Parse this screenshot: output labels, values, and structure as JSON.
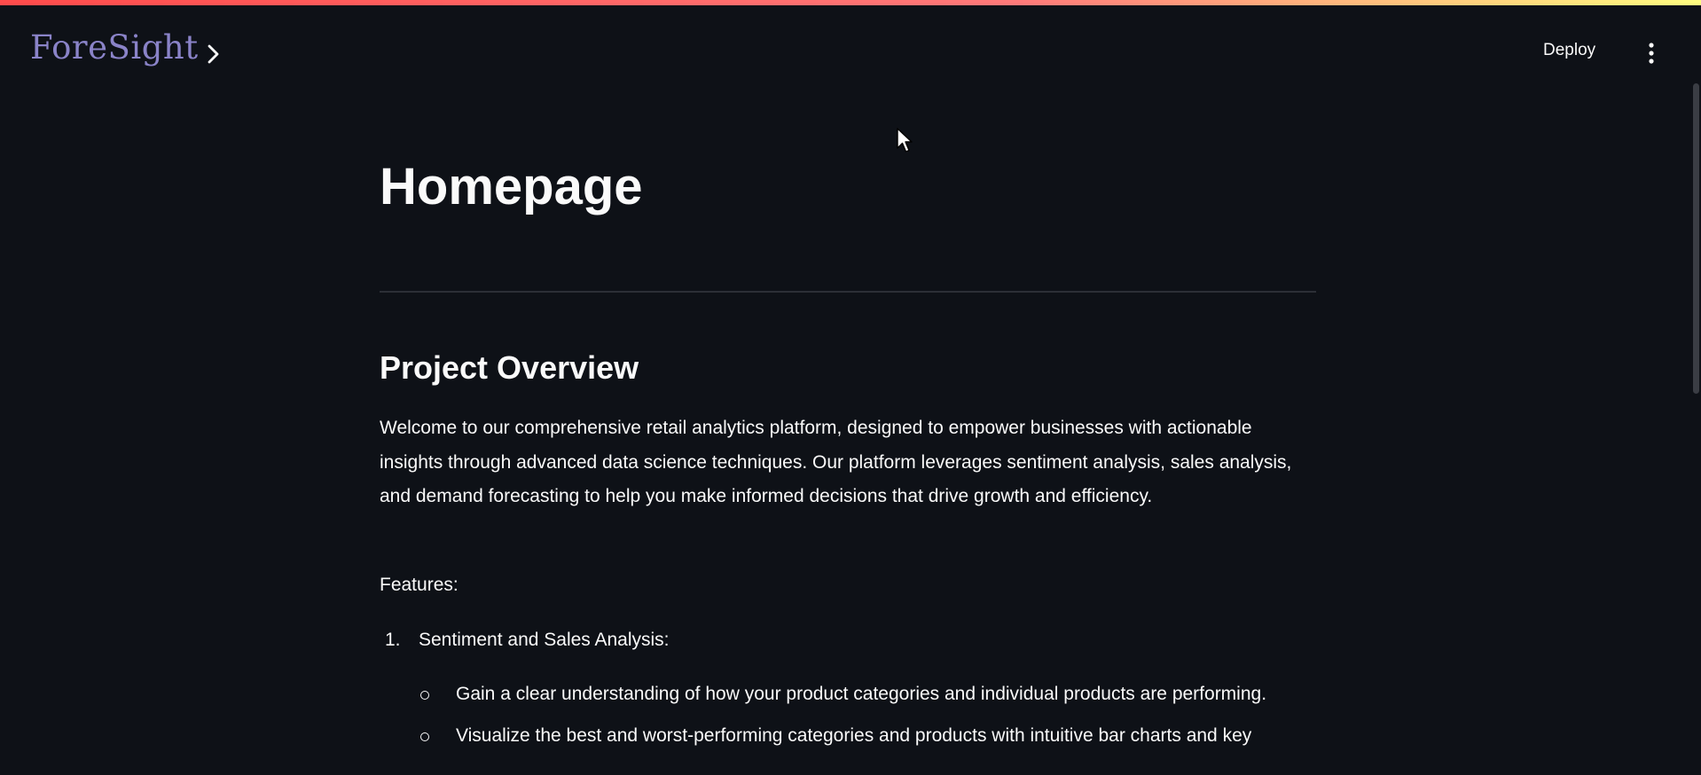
{
  "app": {
    "brand": "ForeSight",
    "deploy_label": "Deploy",
    "accent_gradient": [
      "#ff4b4b",
      "#fffd80"
    ],
    "background": "#0e1117",
    "brand_color": "#8a83c8"
  },
  "page": {
    "title": "Homepage",
    "section_title": "Project Overview",
    "intro": "Welcome to our comprehensive retail analytics platform, designed to empower businesses with actionable insights through advanced data science techniques. Our platform leverages sentiment analysis, sales analysis, and demand forecasting to help you make informed decisions that drive growth and efficiency.",
    "features_label": "Features:",
    "features": [
      {
        "number": "1.",
        "title": "Sentiment and Sales Analysis:",
        "points": [
          "Gain a clear understanding of how your product categories and individual products are performing.",
          "Visualize the best and worst-performing categories and products with intuitive bar charts and key"
        ]
      }
    ]
  }
}
